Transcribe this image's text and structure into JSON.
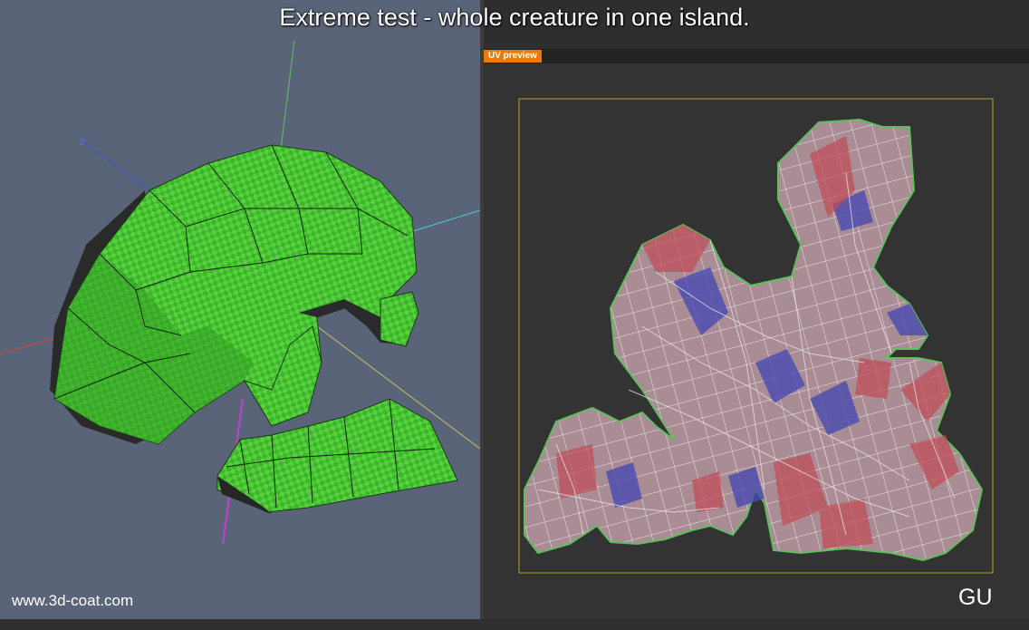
{
  "title": "Extreme test - whole creature in one island.",
  "viewport": {
    "watermark": "www.3d-coat.com",
    "axis_label": "Z",
    "background": "#5a6478",
    "mesh_color": "#3ec12a"
  },
  "uv_panel": {
    "tab_label": "UV preview",
    "tab_color": "#f07800",
    "corner_label": "GU",
    "background": "#333333"
  }
}
